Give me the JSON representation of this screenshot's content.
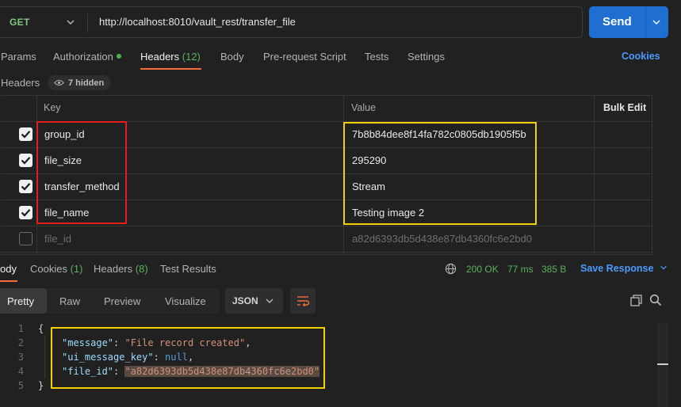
{
  "request": {
    "method": "GET",
    "url": "http://localhost:8010/vault_rest/transfer_file",
    "send_label": "Send"
  },
  "request_tabs": {
    "params": "Params",
    "authorization": "Authorization",
    "headers": "Headers",
    "headers_count": "(12)",
    "body": "Body",
    "prerequest": "Pre-request Script",
    "tests": "Tests",
    "settings": "Settings",
    "cookies": "Cookies"
  },
  "headers_section": {
    "label": "Headers",
    "hidden": "7 hidden",
    "col_key": "Key",
    "col_value": "Value",
    "bulk_edit": "Bulk Edit",
    "rows": [
      {
        "key": "group_id",
        "value": "7b8b84dee8f14fa782c0805db1905f5b",
        "checked": true
      },
      {
        "key": "file_size",
        "value": "295290",
        "checked": true
      },
      {
        "key": "transfer_method",
        "value": "Stream",
        "checked": true
      },
      {
        "key": "file_name",
        "value": "Testing image 2",
        "checked": true
      },
      {
        "key": "file_id",
        "value": "a82d6393db5d438e87db4360fc6e2bd0",
        "checked": false
      }
    ]
  },
  "response": {
    "tabs": {
      "body": "ody",
      "cookies": "Cookies",
      "cookies_count": "(1)",
      "headers": "Headers",
      "headers_count": "(8)",
      "test_results": "Test Results"
    },
    "status": "200 OK",
    "time": "77 ms",
    "size": "385 B",
    "save_label": "Save Response",
    "formats": [
      "Pretty",
      "Raw",
      "Preview",
      "Visualize"
    ],
    "language": "JSON",
    "code": {
      "line_numbers": [
        "1",
        "2",
        "3",
        "4",
        "5"
      ],
      "open_brace": "{",
      "close_brace": "}",
      "lines": [
        {
          "key": "\"message\"",
          "value": "\"File record created\"",
          "trail": ","
        },
        {
          "key": "\"ui_message_key\"",
          "value": "null",
          "trail": ","
        },
        {
          "key": "\"file_id\"",
          "value": "\"a82d6393db5d438e87db4360fc6e2bd0\"",
          "trail": ""
        }
      ]
    }
  },
  "colors": {
    "accent": "#1f6fd1",
    "tab_indicator": "#f26b3a",
    "highlight_red": "#e01e1e",
    "highlight_yellow": "#f0d000"
  }
}
